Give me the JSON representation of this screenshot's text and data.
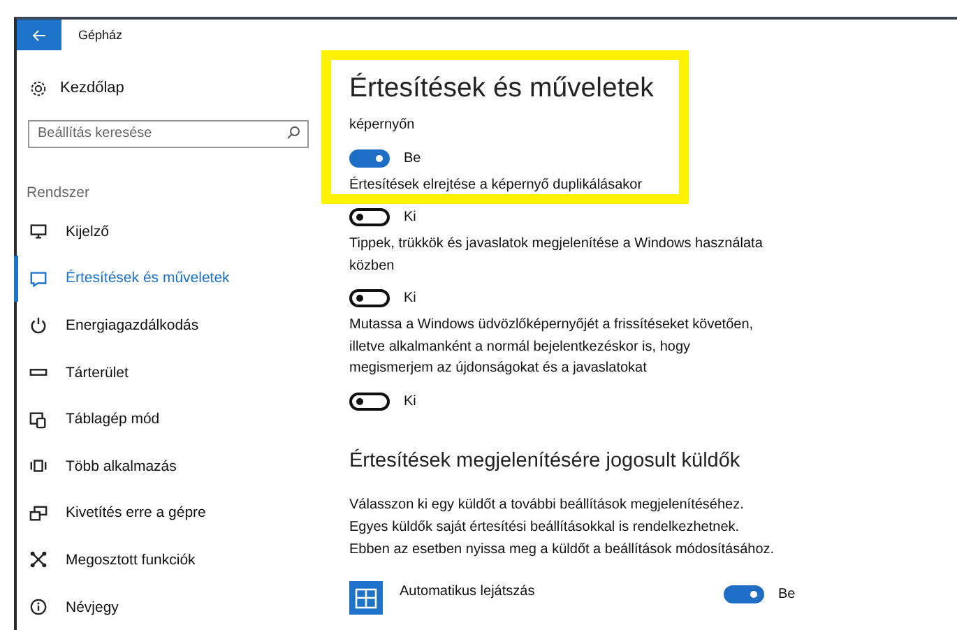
{
  "window": {
    "title": "Gépház"
  },
  "sidebar": {
    "home": "Kezdőlap",
    "search": {
      "placeholder": "Beállítás keresése"
    },
    "section": "Rendszer",
    "items": [
      {
        "label": "Kijelző",
        "selected": false
      },
      {
        "label": "Értesítések és műveletek",
        "selected": true
      },
      {
        "label": "Energiagazdálkodás",
        "selected": false
      },
      {
        "label": "Tárterület",
        "selected": false
      },
      {
        "label": "Táblagép mód",
        "selected": false
      },
      {
        "label": "Több alkalmazás",
        "selected": false
      },
      {
        "label": "Kivetítés erre a gépre",
        "selected": false
      },
      {
        "label": "Megosztott funkciók",
        "selected": false
      },
      {
        "label": "Névjegy",
        "selected": false
      }
    ]
  },
  "content": {
    "title": "Értesítések és műveletek",
    "settings": [
      {
        "lines": [
          "képernyőn"
        ],
        "on": true,
        "state": "Be"
      },
      {
        "lines": [
          "Értesítések elrejtése a képernyő duplikálásakor"
        ],
        "on": false,
        "state": "Ki"
      },
      {
        "lines": [
          "Tippek, trükkök és javaslatok megjelenítése a Windows használata",
          "közben"
        ],
        "on": false,
        "state": "Ki"
      },
      {
        "lines": [
          "Mutassa a Windows üdvözlőképernyőjét a frissítéseket követően,",
          "illetve alkalmanként a normál bejelentkezéskor is, hogy",
          "megismerjem az újdonságokat és a javaslatokat"
        ],
        "on": false,
        "state": "Ki"
      }
    ],
    "senders_title": "Értesítések megjelenítésére jogosult küldők",
    "senders_text": [
      "Válasszon ki egy küldőt a további beállítások megjelenítéséhez.",
      "Egyes küldők saját értesítési beállításokkal is rendelkezhetnek.",
      "Ebben az esetben nyissa meg a küldőt a beállítások módosításához."
    ],
    "apps": [
      {
        "name": "Automatikus lejátszás",
        "on": true,
        "state": "Be"
      }
    ]
  }
}
